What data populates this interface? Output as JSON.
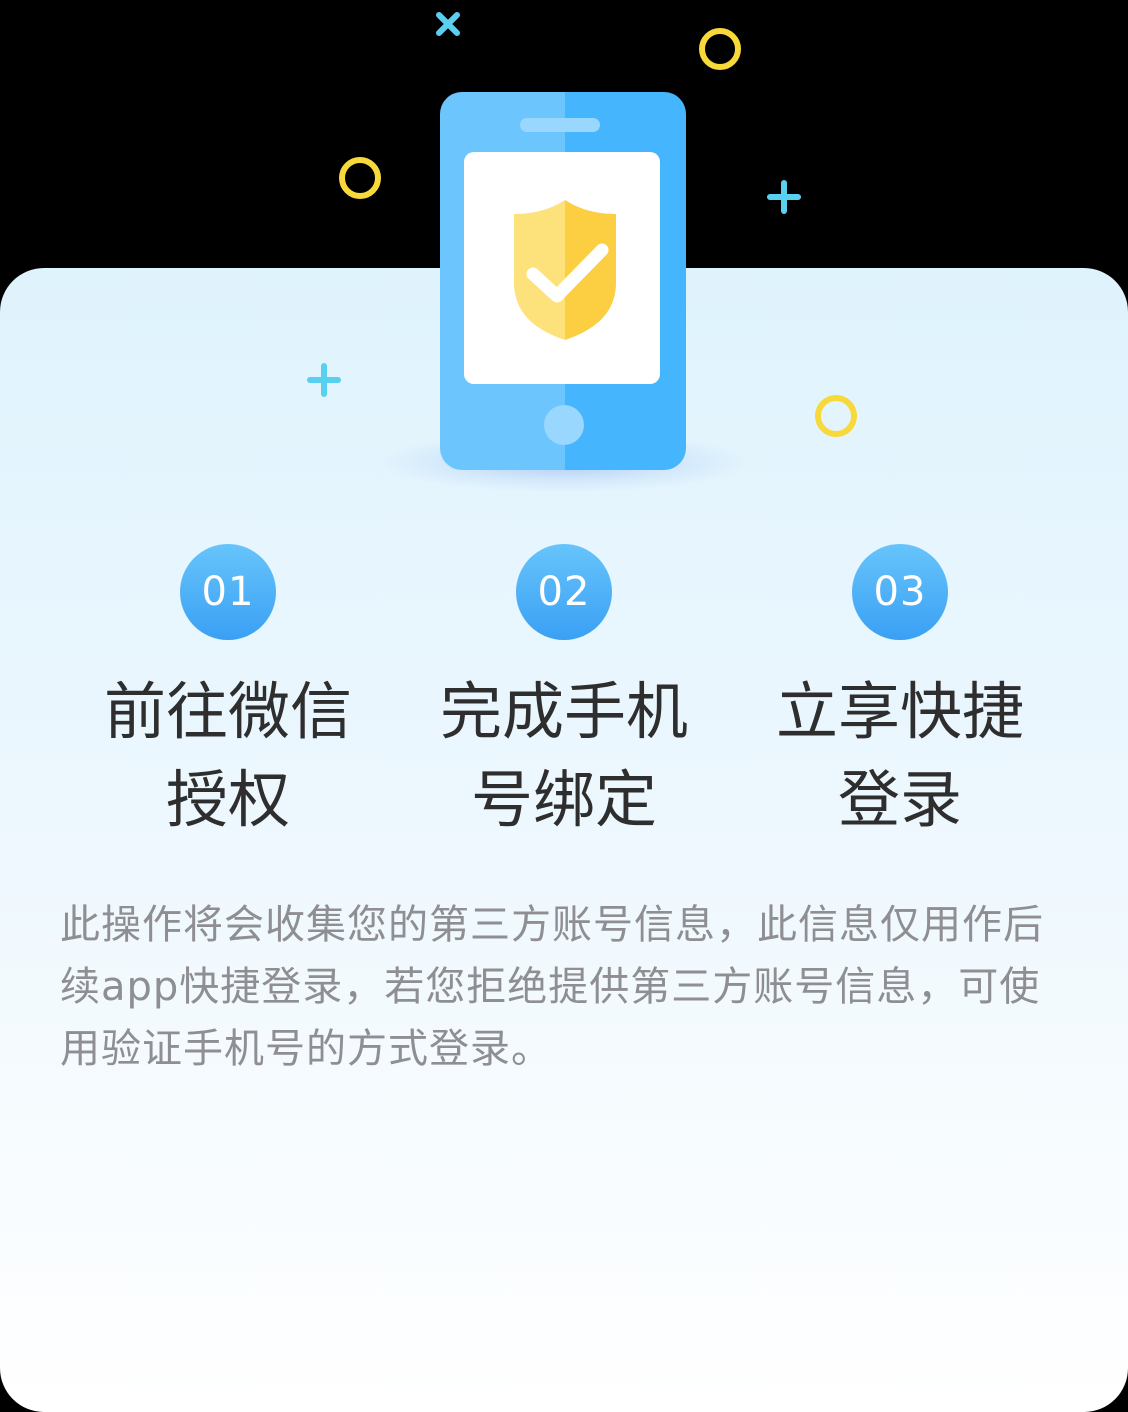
{
  "illustration": {
    "phone_icon": "phone-with-shield-check-icon",
    "decorations": [
      "cross-icon",
      "ring-icon",
      "plus-icon"
    ],
    "colors": {
      "phone_blue": "#5cbcfd",
      "shield_yellow": "#fcd54b",
      "ring_yellow": "#f7d93a",
      "plus_cyan": "#5ad0f0"
    }
  },
  "steps": [
    {
      "number": "01",
      "label": "前往微信授权"
    },
    {
      "number": "02",
      "label": "完成手机号绑定"
    },
    {
      "number": "03",
      "label": "立享快捷登录"
    }
  ],
  "notice": "此操作将会收集您的第三方账号信息，此信息仅用作后续app快捷登录，若您拒绝提供第三方账号信息，可使用验证手机号的方式登录。"
}
